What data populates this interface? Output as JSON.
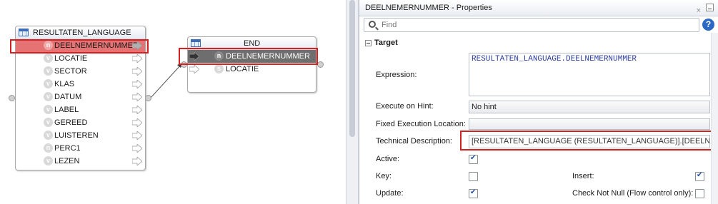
{
  "canvas": {
    "source_table": {
      "name": "RESULTATEN_LANGUAGE",
      "rows": [
        {
          "icon": "n",
          "name": "DEELNEMERNUMMER",
          "selected": true
        },
        {
          "icon": "v",
          "name": "LOCATIE"
        },
        {
          "icon": "v",
          "name": "SECTOR"
        },
        {
          "icon": "v",
          "name": "KLAS"
        },
        {
          "icon": "v",
          "name": "DATUM"
        },
        {
          "icon": "v",
          "name": "LABEL"
        },
        {
          "icon": "v",
          "name": "GEREED"
        },
        {
          "icon": "v",
          "name": "LUISTEREN"
        },
        {
          "icon": "n",
          "name": "PERC1"
        },
        {
          "icon": "v",
          "name": "LEZEN"
        }
      ]
    },
    "target_table": {
      "name": "END",
      "rows": [
        {
          "icon": "n",
          "name": "DEELNEMERNUMMER",
          "selected": true
        },
        {
          "icon": "s",
          "name": "LOCATIE"
        }
      ]
    }
  },
  "properties": {
    "title": "DEELNEMERNUMMER - Properties",
    "close_glyph": "×",
    "search_placeholder": "Find",
    "help_glyph": "?",
    "section": "Target",
    "expression_label": "Expression:",
    "expression_value": "RESULTATEN_LANGUAGE.DEELNEMERNUMMER",
    "execute_on_hint_label": "Execute on Hint:",
    "execute_on_hint_value": "No hint",
    "fixed_execution_location_label": "Fixed Execution Location:",
    "fixed_execution_location_value": "",
    "technical_description_label": "Technical Description:",
    "technical_description_value": "[RESULTATEN_LANGUAGE (RESULTATEN_LANGUAGE)].[DEELNEMERNU",
    "active_label": "Active:",
    "active_checked": true,
    "key_label": "Key:",
    "key_checked": false,
    "insert_label": "Insert:",
    "insert_checked": true,
    "update_label": "Update:",
    "update_checked": true,
    "check_not_null_label": "Check Not Null (Flow control only):",
    "check_not_null_checked": false
  },
  "colors": {
    "highlight_border": "#d42020",
    "selected_row_source": "#e57373",
    "selected_row_target": "#6e6e6e"
  }
}
